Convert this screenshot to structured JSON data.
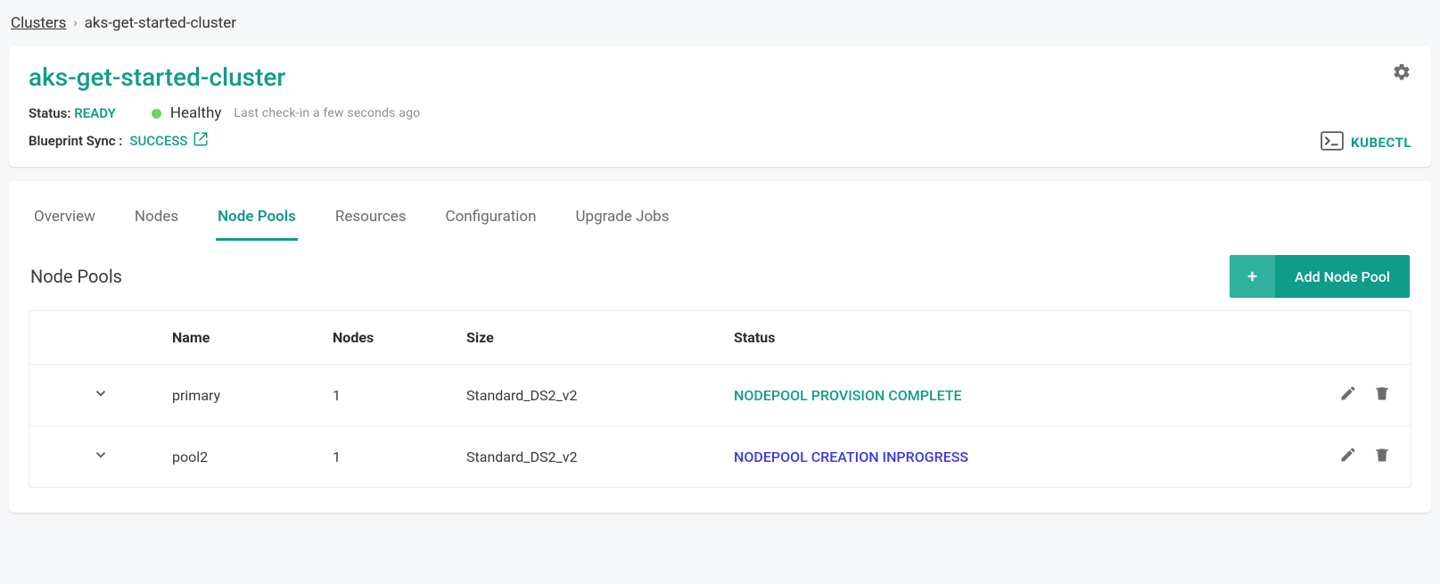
{
  "breadcrumb": {
    "root": "Clusters",
    "current": "aks-get-started-cluster"
  },
  "header": {
    "title": "aks-get-started-cluster",
    "status_label": "Status:",
    "status_value": "READY",
    "health_text": "Healthy",
    "checkin": "Last check-in a few seconds ago",
    "bp_label": "Blueprint Sync :",
    "bp_value": "SUCCESS",
    "kubectl_label": "KUBECTL"
  },
  "tabs": [
    {
      "label": "Overview",
      "active": false
    },
    {
      "label": "Nodes",
      "active": false
    },
    {
      "label": "Node Pools",
      "active": true
    },
    {
      "label": "Resources",
      "active": false
    },
    {
      "label": "Configuration",
      "active": false
    },
    {
      "label": "Upgrade Jobs",
      "active": false
    }
  ],
  "section": {
    "title": "Node Pools",
    "add_label": "Add Node Pool"
  },
  "table": {
    "headers": {
      "name": "Name",
      "nodes": "Nodes",
      "size": "Size",
      "status": "Status"
    },
    "rows": [
      {
        "name": "primary",
        "nodes": "1",
        "size": "Standard_DS2_v2",
        "status": "NODEPOOL PROVISION COMPLETE",
        "status_kind": "complete"
      },
      {
        "name": "pool2",
        "nodes": "1",
        "size": "Standard_DS2_v2",
        "status": "NODEPOOL CREATION INPROGRESS",
        "status_kind": "inprogress"
      }
    ]
  }
}
